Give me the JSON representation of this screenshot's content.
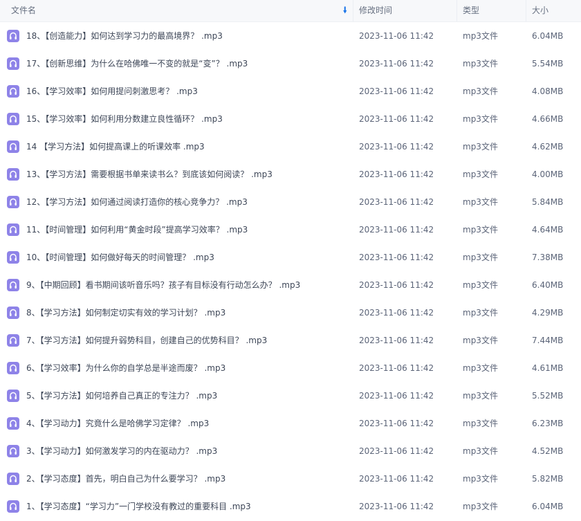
{
  "header": {
    "name_label": "文件名",
    "date_label": "修改时间",
    "type_label": "类型",
    "size_label": "大小",
    "sort_icon": "sort-down-arrow-icon"
  },
  "colors": {
    "file_icon": "#8e83e8",
    "sort_arrow": "#1a74e8"
  },
  "files": [
    {
      "name": "18、【创造能力】如何达到学习力的最高境界？ .mp3",
      "date": "2023-11-06 11:42",
      "type": "mp3文件",
      "size": "6.04MB"
    },
    {
      "name": "17、【创新思维】为什么在哈佛唯一不变的就是“变”？ .mp3",
      "date": "2023-11-06 11:42",
      "type": "mp3文件",
      "size": "5.54MB"
    },
    {
      "name": "16、【学习效率】如何用提问刺激思考？ .mp3",
      "date": "2023-11-06 11:42",
      "type": "mp3文件",
      "size": "4.08MB"
    },
    {
      "name": "15、【学习效率】如何利用分数建立良性循环？ .mp3",
      "date": "2023-11-06 11:42",
      "type": "mp3文件",
      "size": "4.66MB"
    },
    {
      "name": "14 【学习方法】如何提高课上的听课效率 .mp3",
      "date": "2023-11-06 11:42",
      "type": "mp3文件",
      "size": "4.62MB"
    },
    {
      "name": "13、【学习方法】需要根据书单来读书么？到底该如何阅读？ .mp3",
      "date": "2023-11-06 11:42",
      "type": "mp3文件",
      "size": "4.00MB"
    },
    {
      "name": "12、【学习方法】如何通过阅读打造你的核心竞争力？ .mp3",
      "date": "2023-11-06 11:42",
      "type": "mp3文件",
      "size": "5.84MB"
    },
    {
      "name": "11、【时间管理】如何利用“黄金时段”提高学习效率？ .mp3",
      "date": "2023-11-06 11:42",
      "type": "mp3文件",
      "size": "4.64MB"
    },
    {
      "name": "10、【时间管理】如何做好每天的时间管理？ .mp3",
      "date": "2023-11-06 11:42",
      "type": "mp3文件",
      "size": "7.38MB"
    },
    {
      "name": "9、【中期回顾】看书期间该听音乐吗？孩子有目标没有行动怎么办？ .mp3",
      "date": "2023-11-06 11:42",
      "type": "mp3文件",
      "size": "6.40MB"
    },
    {
      "name": "8、【学习方法】如何制定切实有效的学习计划？ .mp3",
      "date": "2023-11-06 11:42",
      "type": "mp3文件",
      "size": "4.29MB"
    },
    {
      "name": "7、【学习方法】如何提升弱势科目，创建自己的优势科目？ .mp3",
      "date": "2023-11-06 11:42",
      "type": "mp3文件",
      "size": "7.44MB"
    },
    {
      "name": "6、【学习效率】为什么你的自学总是半途而废？ .mp3",
      "date": "2023-11-06 11:42",
      "type": "mp3文件",
      "size": "4.61MB"
    },
    {
      "name": "5、【学习方法】如何培养自己真正的专注力？ .mp3",
      "date": "2023-11-06 11:42",
      "type": "mp3文件",
      "size": "5.52MB"
    },
    {
      "name": "4、【学习动力】究竟什么是哈佛学习定律？ .mp3",
      "date": "2023-11-06 11:42",
      "type": "mp3文件",
      "size": "6.23MB"
    },
    {
      "name": "3、【学习动力】如何激发学习的内在驱动力？ .mp3",
      "date": "2023-11-06 11:42",
      "type": "mp3文件",
      "size": "4.52MB"
    },
    {
      "name": "2、【学习态度】首先，明白自己为什么要学习？ .mp3",
      "date": "2023-11-06 11:42",
      "type": "mp3文件",
      "size": "5.82MB"
    },
    {
      "name": "1、【学习态度】“学习力”一门学校没有教过的重要科目 .mp3",
      "date": "2023-11-06 11:42",
      "type": "mp3文件",
      "size": "6.04MB"
    }
  ]
}
